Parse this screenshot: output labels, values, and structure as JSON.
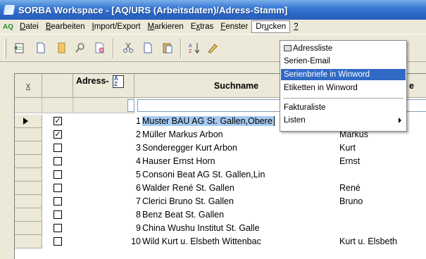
{
  "window": {
    "title": "SORBA Workspace - [AQ/URS (Arbeitsdaten)/Adress-Stamm]"
  },
  "menubar": {
    "app_icon": "AQ",
    "items": [
      {
        "pre": "",
        "u": "D",
        "post": "atei"
      },
      {
        "pre": "",
        "u": "B",
        "post": "earbeiten"
      },
      {
        "pre": "",
        "u": "I",
        "post": "mport/Export"
      },
      {
        "pre": "",
        "u": "M",
        "post": "arkieren"
      },
      {
        "pre": "E",
        "u": "x",
        "post": "tras"
      },
      {
        "pre": "",
        "u": "F",
        "post": "enster"
      },
      {
        "pre": "Dr",
        "u": "u",
        "post": "cken"
      },
      {
        "pre": "",
        "u": "?",
        "post": ""
      }
    ]
  },
  "toolbar": {
    "icons": [
      "new-record-icon",
      "document-icon",
      "folder-icon",
      "find-icon",
      "preview-icon",
      "cut-icon",
      "copy-icon",
      "paste-icon",
      "sort-az-icon",
      "edit-icon"
    ]
  },
  "grid": {
    "headers": {
      "select": "x",
      "adress_nr": "Adress-",
      "name": "Suchname",
      "vorname": "e"
    },
    "rows": [
      {
        "num": "1",
        "checked": true,
        "name": "Muster BAU AG St. Gallen,Obere",
        "vorname": "",
        "current": true
      },
      {
        "num": "2",
        "checked": true,
        "name": "Müller Markus Arbon",
        "vorname": "Markus"
      },
      {
        "num": "3",
        "checked": false,
        "name": "Sonderegger Kurt Arbon",
        "vorname": "Kurt"
      },
      {
        "num": "4",
        "checked": false,
        "name": "Hauser Ernst Horn",
        "vorname": "Ernst"
      },
      {
        "num": "5",
        "checked": false,
        "name": "Consoni Beat AG St. Gallen,Lin",
        "vorname": ""
      },
      {
        "num": "6",
        "checked": false,
        "name": "Walder René St. Gallen",
        "vorname": "René"
      },
      {
        "num": "7",
        "checked": false,
        "name": "Clerici Bruno St. Gallen",
        "vorname": "Bruno"
      },
      {
        "num": "8",
        "checked": false,
        "name": "Benz Beat St. Gallen",
        "vorname": ""
      },
      {
        "num": "9",
        "checked": false,
        "name": "China Wushu Institut St. Galle",
        "vorname": ""
      },
      {
        "num": "10",
        "checked": false,
        "name": "Wild Kurt u. Elsbeth Wittenbac",
        "vorname": "Kurt u. Elsbeth"
      }
    ]
  },
  "drucken_menu": {
    "items": [
      {
        "label": "Adressliste",
        "icon": "printer-icon"
      },
      {
        "label": "Serien-Email"
      },
      {
        "label": "Serienbriefe in Winword",
        "active": true
      },
      {
        "label": "Etiketten in Winword"
      },
      {
        "label": "Fakturaliste"
      },
      {
        "label": "Listen",
        "submenu": true
      }
    ]
  },
  "colors": {
    "titlebar": "#2a66c8",
    "highlight": "#316ac5",
    "row_selection": "#a6caf0",
    "chrome": "#ece9d8"
  }
}
